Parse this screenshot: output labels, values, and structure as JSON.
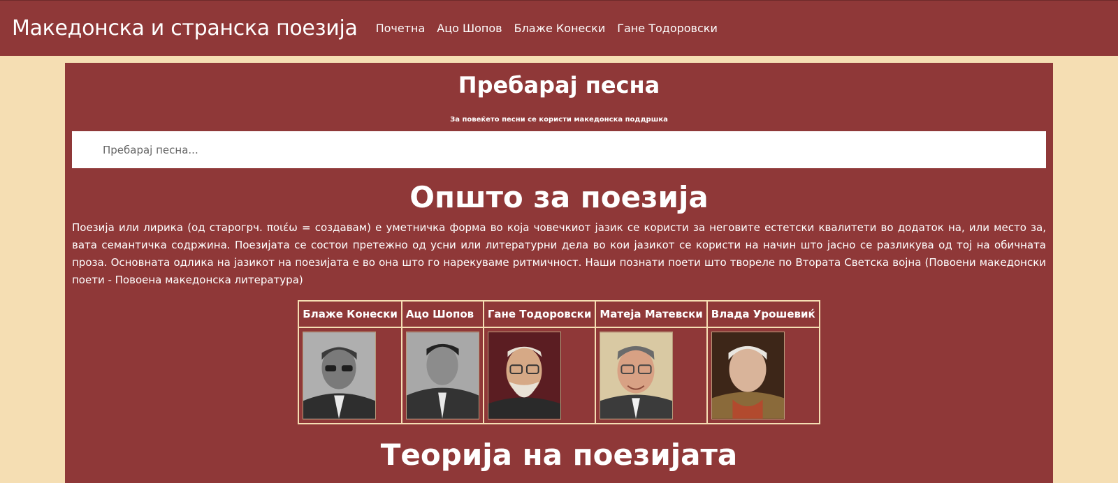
{
  "navbar": {
    "brand": "Македонска и странска поезија",
    "links": [
      "Почетна",
      "Ацо Шопов",
      "Блаже Конески",
      "Гане Тодоровски"
    ]
  },
  "search": {
    "title": "Пребарај песна",
    "note": "За повеќето песни се користи македонска поддршка",
    "placeholder": "Пребарај песна..."
  },
  "general": {
    "title": "Општо за поезија",
    "text": "Поезија или лирика (од старогрч. ποιέω = создавам) е уметничка форма во која човечкиот јазик се користи за неговите естетски квалитети во додаток на, или место за, вата семантичка содржина. Поезијата се состои претежно од усни или литературни дела во кои јазикот се користи на начин што јасно се разликува од тој на обичната проза. Основната одлика на јазикот на поезијата е во она што го нарекуваме ритмичност. Наши познати поети што твореле по Втората Светска војна (Повоени македонски поети - Повоена македонска литература)"
  },
  "poets": [
    {
      "name": "Блаже Конески",
      "portrait_icon": "portrait-photo-bw"
    },
    {
      "name": "Ацо Шопов",
      "portrait_icon": "portrait-photo-bw"
    },
    {
      "name": "Гане Тодоровски",
      "portrait_icon": "portrait-photo-color"
    },
    {
      "name": "Матеја Матевски",
      "portrait_icon": "portrait-photo-color"
    },
    {
      "name": "Влада Урошевиќ",
      "portrait_icon": "portrait-photo-color"
    }
  ],
  "theory": {
    "title": "Теорија на поезијата"
  },
  "colors": {
    "primary": "#8f3838",
    "background": "#f5deb3",
    "text": "#ffffff"
  }
}
